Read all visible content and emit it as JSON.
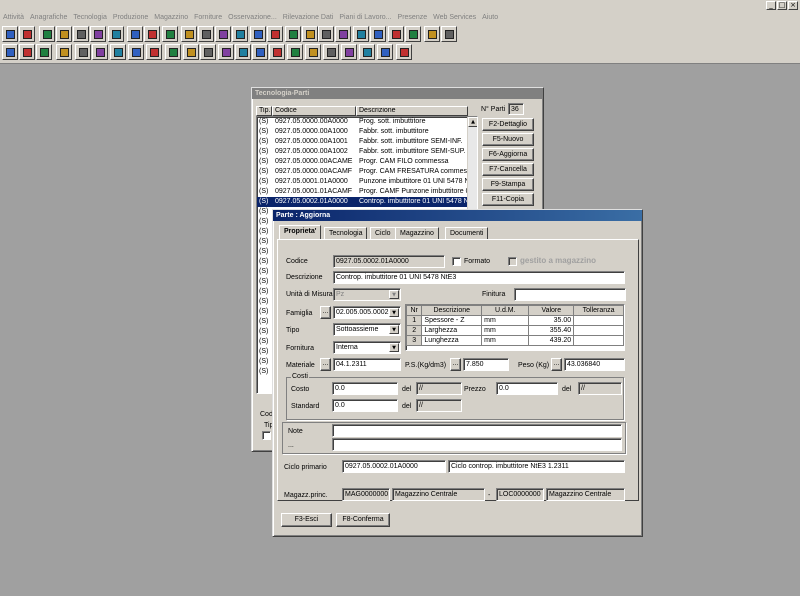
{
  "window_controls": [
    "_",
    "□",
    "×"
  ],
  "menu": [
    "Attività",
    "Anagrafiche",
    "Tecnologia",
    "Produzione",
    "Magazzino",
    "Forniture",
    "Osservazione...",
    "Rilevazione Dati",
    "Piani di Lavoro...",
    "Presenze",
    "Web Services",
    "Aiuto"
  ],
  "parts_window": {
    "title": "Tecnologia-Parti",
    "columns": [
      "Tip.",
      "Codice",
      "Descrizione"
    ],
    "count_label": "N° Parti",
    "count": "36",
    "rows": [
      {
        "tip": "(S)",
        "codice": "0927.05.0000.00A0000",
        "descrizione": "Prog. sott. imbuttitore"
      },
      {
        "tip": "(S)",
        "codice": "0927.05.0000.00A1000",
        "descrizione": "Fabbr. sott. imbuttitore"
      },
      {
        "tip": "(S)",
        "codice": "0927.05.0000.00A1001",
        "descrizione": "Fabbr. sott. imbuttitore SEMI-INF."
      },
      {
        "tip": "(S)",
        "codice": "0927.05.0000.00A1002",
        "descrizione": "Fabbr. sott. imbuttitore SEMI-SUP."
      },
      {
        "tip": "(S)",
        "codice": "0927.05.0000.00ACAME",
        "descrizione": "Progr. CAM FILO commessa"
      },
      {
        "tip": "(S)",
        "codice": "0927.05.0000.00ACAMF",
        "descrizione": "Progr. CAM FRESATURA commess,"
      },
      {
        "tip": "(S)",
        "codice": "0927.05.0001.01A0000",
        "descrizione": "Punzone imbuttitore 01 UNI 5478 NtE"
      },
      {
        "tip": "(S)",
        "codice": "0927.05.0001.01ACAMF",
        "descrizione": "Progr. CAMF Punzone imbuttitore 01"
      },
      {
        "tip": "(S)",
        "codice": "0927.05.0002.01A0000",
        "descrizione": "Controp. imbuttitore 01 UNI 5478 NtE",
        "selected": true
      }
    ],
    "extra_tips": [
      "(S)",
      "(S)",
      "(S)",
      "(S)",
      "(S)",
      "(S)",
      "(S)",
      "(S)",
      "(S)",
      "(S)",
      "(S)",
      "(S)",
      "(S)",
      "(S)",
      "(S)",
      "(S)",
      "(S)"
    ],
    "buttons": [
      "F2-Dettaglio",
      "F5-Nuovo",
      "F6-Aggiorna",
      "F7-Cancella",
      "F9-Stampa",
      "F11-Copia"
    ],
    "bottom_label": "Codi",
    "bottom_label2": "Tip"
  },
  "update_window": {
    "title": "Parte : Aggiorna",
    "tabs": [
      "Proprieta'",
      "Tecnologia",
      "Ciclo",
      "Magazzino",
      "Documenti"
    ],
    "codice_label": "Codice",
    "codice": "0927.05.0002.01A0000",
    "formato_label": "Formato",
    "gestito_label": "gestito a magazzino",
    "descrizione_label": "Descrizione",
    "descrizione": "Controp. imbuttitore 01 UNI 5478 NtE3",
    "unita_label": "Unità di Misura",
    "unita": "Pz",
    "finitura_label": "Finitura",
    "finitura": "",
    "famiglia_label": "Famiglia",
    "famiglia": "02.005.005.0002",
    "tipo_label": "Tipo",
    "tipo": "Sottoassieme",
    "fornitura_label": "Fornitura",
    "fornitura": "Interna",
    "dims_columns": [
      "Nr",
      "Descrizione",
      "U.d.M.",
      "Valore",
      "Tolleranza"
    ],
    "dims": [
      {
        "nr": "1",
        "descrizione": "Spessore - Z",
        "udm": "mm",
        "valore": "35.00",
        "tolleranza": ""
      },
      {
        "nr": "2",
        "descrizione": "Larghezza",
        "udm": "mm",
        "valore": "355.40",
        "tolleranza": ""
      },
      {
        "nr": "3",
        "descrizione": "Lunghezza",
        "udm": "mm",
        "valore": "439.20",
        "tolleranza": ""
      }
    ],
    "materiale_label": "Materiale",
    "materiale": "04.1.2311",
    "ps_label": "P.S.(Kg/dm3)",
    "ps": "7.850",
    "peso_label": "Peso (Kg)",
    "peso": "43.036840",
    "costi_label": "Costi",
    "costo_label": "Costo",
    "costo": "0.0",
    "del_label": "del",
    "costo_del": "//",
    "prezzo_label": "Prezzo",
    "prezzo": "0.0",
    "prezzo_del": "//",
    "standard_label": "Standard",
    "standard": "0.0",
    "standard_del": "//",
    "note_label": "Note",
    "note2_label": "...",
    "ciclo_label": "Ciclo primario",
    "ciclo_code": "0927.05.0002.01A0000",
    "ciclo_desc": "Ciclo controp. imbuttitore NtE3 1.2311",
    "magazz_label": "Magazz.princ.",
    "mag_code": "MAG0000000",
    "mag_desc": "Magazzino Centrale",
    "loc_code": "LOC0000000",
    "loc_desc": "Magazzino Centrale",
    "esci": "F3-Esci",
    "conferma": "F8-Conferma",
    "dots": "...",
    "dash": "-"
  }
}
